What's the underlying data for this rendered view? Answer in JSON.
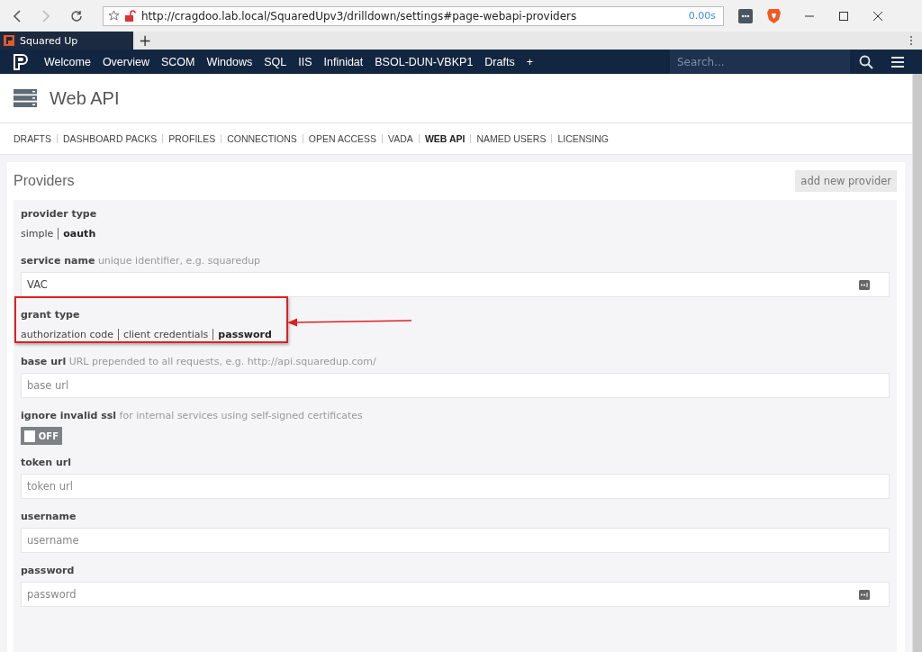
{
  "browser": {
    "url": "http://cragdoo.lab.local/SquaredUpv3/drilldown/settings#page-webapi-providers",
    "load_time": "0.00s",
    "tab_title": "Squared Up",
    "new_tab": "+"
  },
  "nav": {
    "items": [
      "Welcome",
      "Overview",
      "SCOM",
      "Windows",
      "SQL",
      "IIS",
      "Infinidat",
      "BSOL-DUN-VBKP1",
      "Drafts"
    ],
    "add": "+",
    "search": {
      "placeholder": "Search..."
    }
  },
  "page": {
    "title": "Web API"
  },
  "tabs": [
    {
      "label": "DRAFTS",
      "selected": false
    },
    {
      "label": "DASHBOARD PACKS",
      "selected": false
    },
    {
      "label": "PROFILES",
      "selected": false
    },
    {
      "label": "CONNECTIONS",
      "selected": false
    },
    {
      "label": "OPEN ACCESS",
      "selected": false
    },
    {
      "label": "VADA",
      "selected": false
    },
    {
      "label": "WEB API",
      "selected": true
    },
    {
      "label": "NAMED USERS",
      "selected": false
    },
    {
      "label": "LICENSING",
      "selected": false
    }
  ],
  "providers": {
    "title": "Providers",
    "add_button": "add new provider",
    "fields": [
      {
        "kind": "choice",
        "label": "provider type",
        "options": [
          {
            "label": "simple",
            "selected": false
          },
          {
            "label": "oauth",
            "selected": true
          }
        ]
      },
      {
        "kind": "input_menu",
        "label": "service name",
        "hint": "unique identifier, e.g. squaredup",
        "value": "VAC"
      },
      {
        "kind": "choice",
        "label": "grant type",
        "annotated": true,
        "options": [
          {
            "label": "authorization code",
            "selected": false
          },
          {
            "label": "client credentials",
            "selected": false
          },
          {
            "label": "password",
            "selected": true
          }
        ]
      },
      {
        "kind": "input",
        "label": "base url",
        "hint": "URL prepended to all requests, e.g. http://api.squaredup.com/",
        "placeholder": "base url"
      },
      {
        "kind": "toggle",
        "label": "ignore invalid ssl",
        "hint": "for internal services using self-signed certificates",
        "on": false,
        "state_text": "OFF"
      },
      {
        "kind": "input",
        "label": "token url",
        "placeholder": "token url"
      },
      {
        "kind": "input",
        "label": "username",
        "placeholder": "username"
      },
      {
        "kind": "input_menu",
        "label": "password",
        "placeholder": "password"
      }
    ]
  }
}
